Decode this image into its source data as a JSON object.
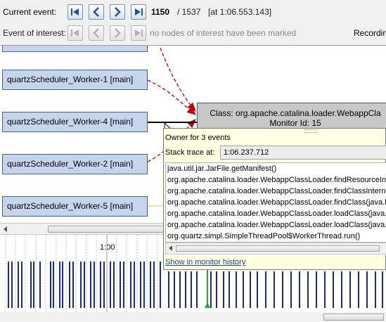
{
  "toolbar": {
    "current_event_label": "Current event:",
    "event_of_interest_label": "Event of interest:",
    "current_index": "1150",
    "total": "/ 1537",
    "timestamp": "[at 1:06.553.143]",
    "interest_note": "no nodes of interest have been marked",
    "recording_label": "Recording"
  },
  "graph": {
    "nodes": [
      "quartzScheduler_Worker-1 [main]",
      "quartzScheduler_Worker-4 [main]",
      "quartzScheduler_Worker-2 [main]",
      "quartzScheduler_Worker-5 [main]"
    ],
    "target": {
      "class_line": "Class: org.apache.catalina.loader.WebappCla",
      "monitor_line": "Monitor Id: 15"
    }
  },
  "timeline": {
    "tick_label": "1:00"
  },
  "popup": {
    "owner_text": "Owner for 3 events",
    "stack_trace_label": "Stack trace at:",
    "stack_trace_value": "1:06.237.712",
    "frames": [
      "java.util.jar.JarFile.getManifest()",
      "org.apache.catalina.loader.WebappClassLoader.findResourceInt",
      "org.apache.catalina.loader.WebappClassLoader.findClassInterna",
      "org.apache.catalina.loader.WebappClassLoader.findClass(java.la",
      "org.apache.catalina.loader.WebappClassLoader.loadClass(java.l",
      "org.apache.catalina.loader.WebappClassLoader.loadClass(java.l",
      "org.quartz.simpl.SimpleThreadPool$WorkerThread.run()"
    ],
    "link": "Show in monitor history"
  },
  "colors": {
    "node_fill": "#c5d5ee",
    "node_border": "#4b5f86",
    "wait_arrow": "#c00000",
    "owner_arrow": "#000000",
    "timeline_bar": "#1a2a8c",
    "current_marker": "#22aa22",
    "popup_bg": "#ffffe1"
  },
  "icons": {
    "first": "skip-first-icon",
    "prev": "previous-icon",
    "next": "next-icon",
    "last": "skip-last-icon"
  }
}
